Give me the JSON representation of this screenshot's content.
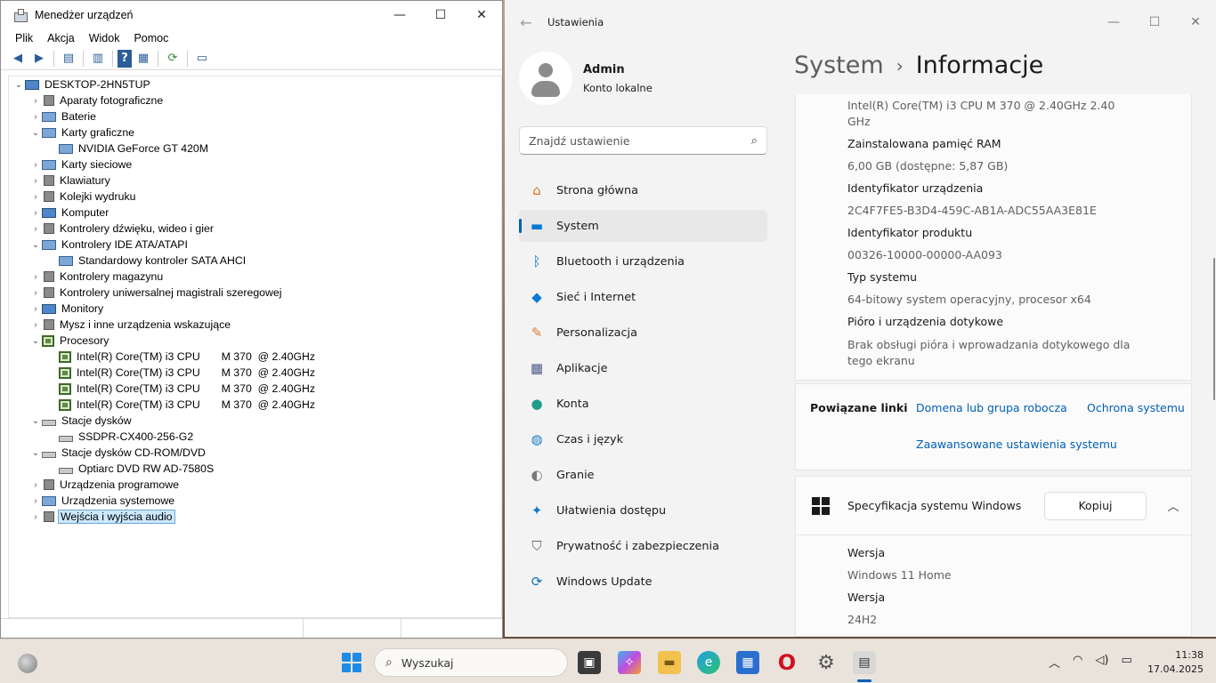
{
  "device_manager": {
    "title": "Menedżer urządzeń",
    "menu": [
      "Plik",
      "Akcja",
      "Widok",
      "Pomoc"
    ],
    "tree": [
      {
        "level": 0,
        "exp": "⌄",
        "icon": "comp",
        "label": "DESKTOP-2HN5TUP"
      },
      {
        "level": 1,
        "exp": "›",
        "icon": "gray",
        "label": "Aparaty fotograficzne"
      },
      {
        "level": 1,
        "exp": "›",
        "icon": "dev",
        "label": "Baterie"
      },
      {
        "level": 1,
        "exp": "⌄",
        "icon": "dev",
        "label": "Karty graficzne"
      },
      {
        "level": 2,
        "exp": "",
        "icon": "dev",
        "label": "NVIDIA GeForce GT 420M"
      },
      {
        "level": 1,
        "exp": "›",
        "icon": "dev",
        "label": "Karty sieciowe"
      },
      {
        "level": 1,
        "exp": "›",
        "icon": "gray",
        "label": "Klawiatury"
      },
      {
        "level": 1,
        "exp": "›",
        "icon": "gray",
        "label": "Kolejki wydruku"
      },
      {
        "level": 1,
        "exp": "›",
        "icon": "comp",
        "label": "Komputer"
      },
      {
        "level": 1,
        "exp": "›",
        "icon": "gray",
        "label": "Kontrolery dźwięku, wideo i gier"
      },
      {
        "level": 1,
        "exp": "⌄",
        "icon": "dev",
        "label": "Kontrolery IDE ATA/ATAPI"
      },
      {
        "level": 2,
        "exp": "",
        "icon": "dev",
        "label": "Standardowy kontroler SATA AHCI"
      },
      {
        "level": 1,
        "exp": "›",
        "icon": "gray",
        "label": "Kontrolery magazynu"
      },
      {
        "level": 1,
        "exp": "›",
        "icon": "gray",
        "label": "Kontrolery uniwersalnej magistrali szeregowej"
      },
      {
        "level": 1,
        "exp": "›",
        "icon": "comp",
        "label": "Monitory"
      },
      {
        "level": 1,
        "exp": "›",
        "icon": "gray",
        "label": "Mysz i inne urządzenia wskazujące"
      },
      {
        "level": 1,
        "exp": "⌄",
        "icon": "chip",
        "label": "Procesory"
      },
      {
        "level": 2,
        "exp": "",
        "icon": "chip",
        "label": "Intel(R) Core(TM) i3 CPU       M 370  @ 2.40GHz"
      },
      {
        "level": 2,
        "exp": "",
        "icon": "chip",
        "label": "Intel(R) Core(TM) i3 CPU       M 370  @ 2.40GHz"
      },
      {
        "level": 2,
        "exp": "",
        "icon": "chip",
        "label": "Intel(R) Core(TM) i3 CPU       M 370  @ 2.40GHz"
      },
      {
        "level": 2,
        "exp": "",
        "icon": "chip",
        "label": "Intel(R) Core(TM) i3 CPU       M 370  @ 2.40GHz"
      },
      {
        "level": 1,
        "exp": "⌄",
        "icon": "disk",
        "label": "Stacje dysków"
      },
      {
        "level": 2,
        "exp": "",
        "icon": "disk",
        "label": "SSDPR-CX400-256-G2"
      },
      {
        "level": 1,
        "exp": "⌄",
        "icon": "disk",
        "label": "Stacje dysków CD-ROM/DVD"
      },
      {
        "level": 2,
        "exp": "",
        "icon": "disk",
        "label": "Optiarc DVD RW AD-7580S"
      },
      {
        "level": 1,
        "exp": "›",
        "icon": "gray",
        "label": "Urządzenia programowe"
      },
      {
        "level": 1,
        "exp": "›",
        "icon": "dev",
        "label": "Urządzenia systemowe"
      },
      {
        "level": 1,
        "exp": "›",
        "icon": "gray",
        "label": "Wejścia i wyjścia audio",
        "selected": true
      }
    ]
  },
  "settings": {
    "app_title": "Ustawienia",
    "user_name": "Admin",
    "user_sub": "Konto lokalne",
    "search_placeholder": "Znajdź ustawienie",
    "nav": [
      {
        "label": "Strona główna",
        "icon": "home-icon",
        "glyph": "⌂",
        "color": "#d4762c"
      },
      {
        "label": "System",
        "icon": "system-icon",
        "glyph": "▬",
        "color": "#0078d4",
        "active": true
      },
      {
        "label": "Bluetooth i urządzenia",
        "icon": "bluetooth-icon",
        "glyph": "ᛒ",
        "color": "#0078d4"
      },
      {
        "label": "Sieć i Internet",
        "icon": "wifi-icon",
        "glyph": "◆",
        "color": "#0a7bd6"
      },
      {
        "label": "Personalizacja",
        "icon": "brush-icon",
        "glyph": "✎",
        "color": "#e07a3a"
      },
      {
        "label": "Aplikacje",
        "icon": "apps-icon",
        "glyph": "▦",
        "color": "#4a5a8a"
      },
      {
        "label": "Konta",
        "icon": "account-icon",
        "glyph": "●",
        "color": "#1f9c8a"
      },
      {
        "label": "Czas i język",
        "icon": "globe-icon",
        "glyph": "◍",
        "color": "#1a78c2"
      },
      {
        "label": "Granie",
        "icon": "gamepad-icon",
        "glyph": "◐",
        "color": "#7a7a7a"
      },
      {
        "label": "Ułatwienia dostępu",
        "icon": "accessibility-icon",
        "glyph": "✦",
        "color": "#1a78c2"
      },
      {
        "label": "Prywatność i zabezpieczenia",
        "icon": "shield-icon",
        "glyph": "⛉",
        "color": "#6a6a6a"
      },
      {
        "label": "Windows Update",
        "icon": "update-icon",
        "glyph": "⟳",
        "color": "#0a6fc2"
      }
    ],
    "breadcrumb_parent": "System",
    "breadcrumb_current": "Informacje",
    "info": {
      "cpu_line1": "Intel(R) Core(TM) i3 CPU       M 370  @ 2.40GHz   2.40",
      "cpu_line2": "GHz",
      "ram_label": "Zainstalowana pamięć RAM",
      "ram_value": "6,00 GB (dostępne: 5,87 GB)",
      "device_id_label": "Identyfikator urządzenia",
      "device_id_value": "2C4F7FE5-B3D4-459C-AB1A-ADC55AA3E81E",
      "product_id_label": "Identyfikator produktu",
      "product_id_value": "00326-10000-00000-AA093",
      "system_type_label": "Typ systemu",
      "system_type_value": "64-bitowy system operacyjny, procesor x64",
      "pen_label": "Pióro i urządzenia dotykowe",
      "pen_value_1": "Brak obsługi pióra i wprowadzania dotykowego dla",
      "pen_value_2": "tego ekranu"
    },
    "links": {
      "title": "Powiązane linki",
      "domain": "Domena lub grupa robocza",
      "protection": "Ochrona systemu",
      "advanced": "Zaawansowane ustawienia systemu"
    },
    "spec": {
      "title": "Specyfikacja systemu Windows",
      "copy": "Kopiuj",
      "edition_label": "Wersja",
      "edition_value": "Windows 11 Home",
      "version_label": "Wersja",
      "version_value": "24H2"
    }
  },
  "taskbar": {
    "search_placeholder": "Wyszukaj",
    "time": "11:38",
    "date": "17.04.2025"
  }
}
